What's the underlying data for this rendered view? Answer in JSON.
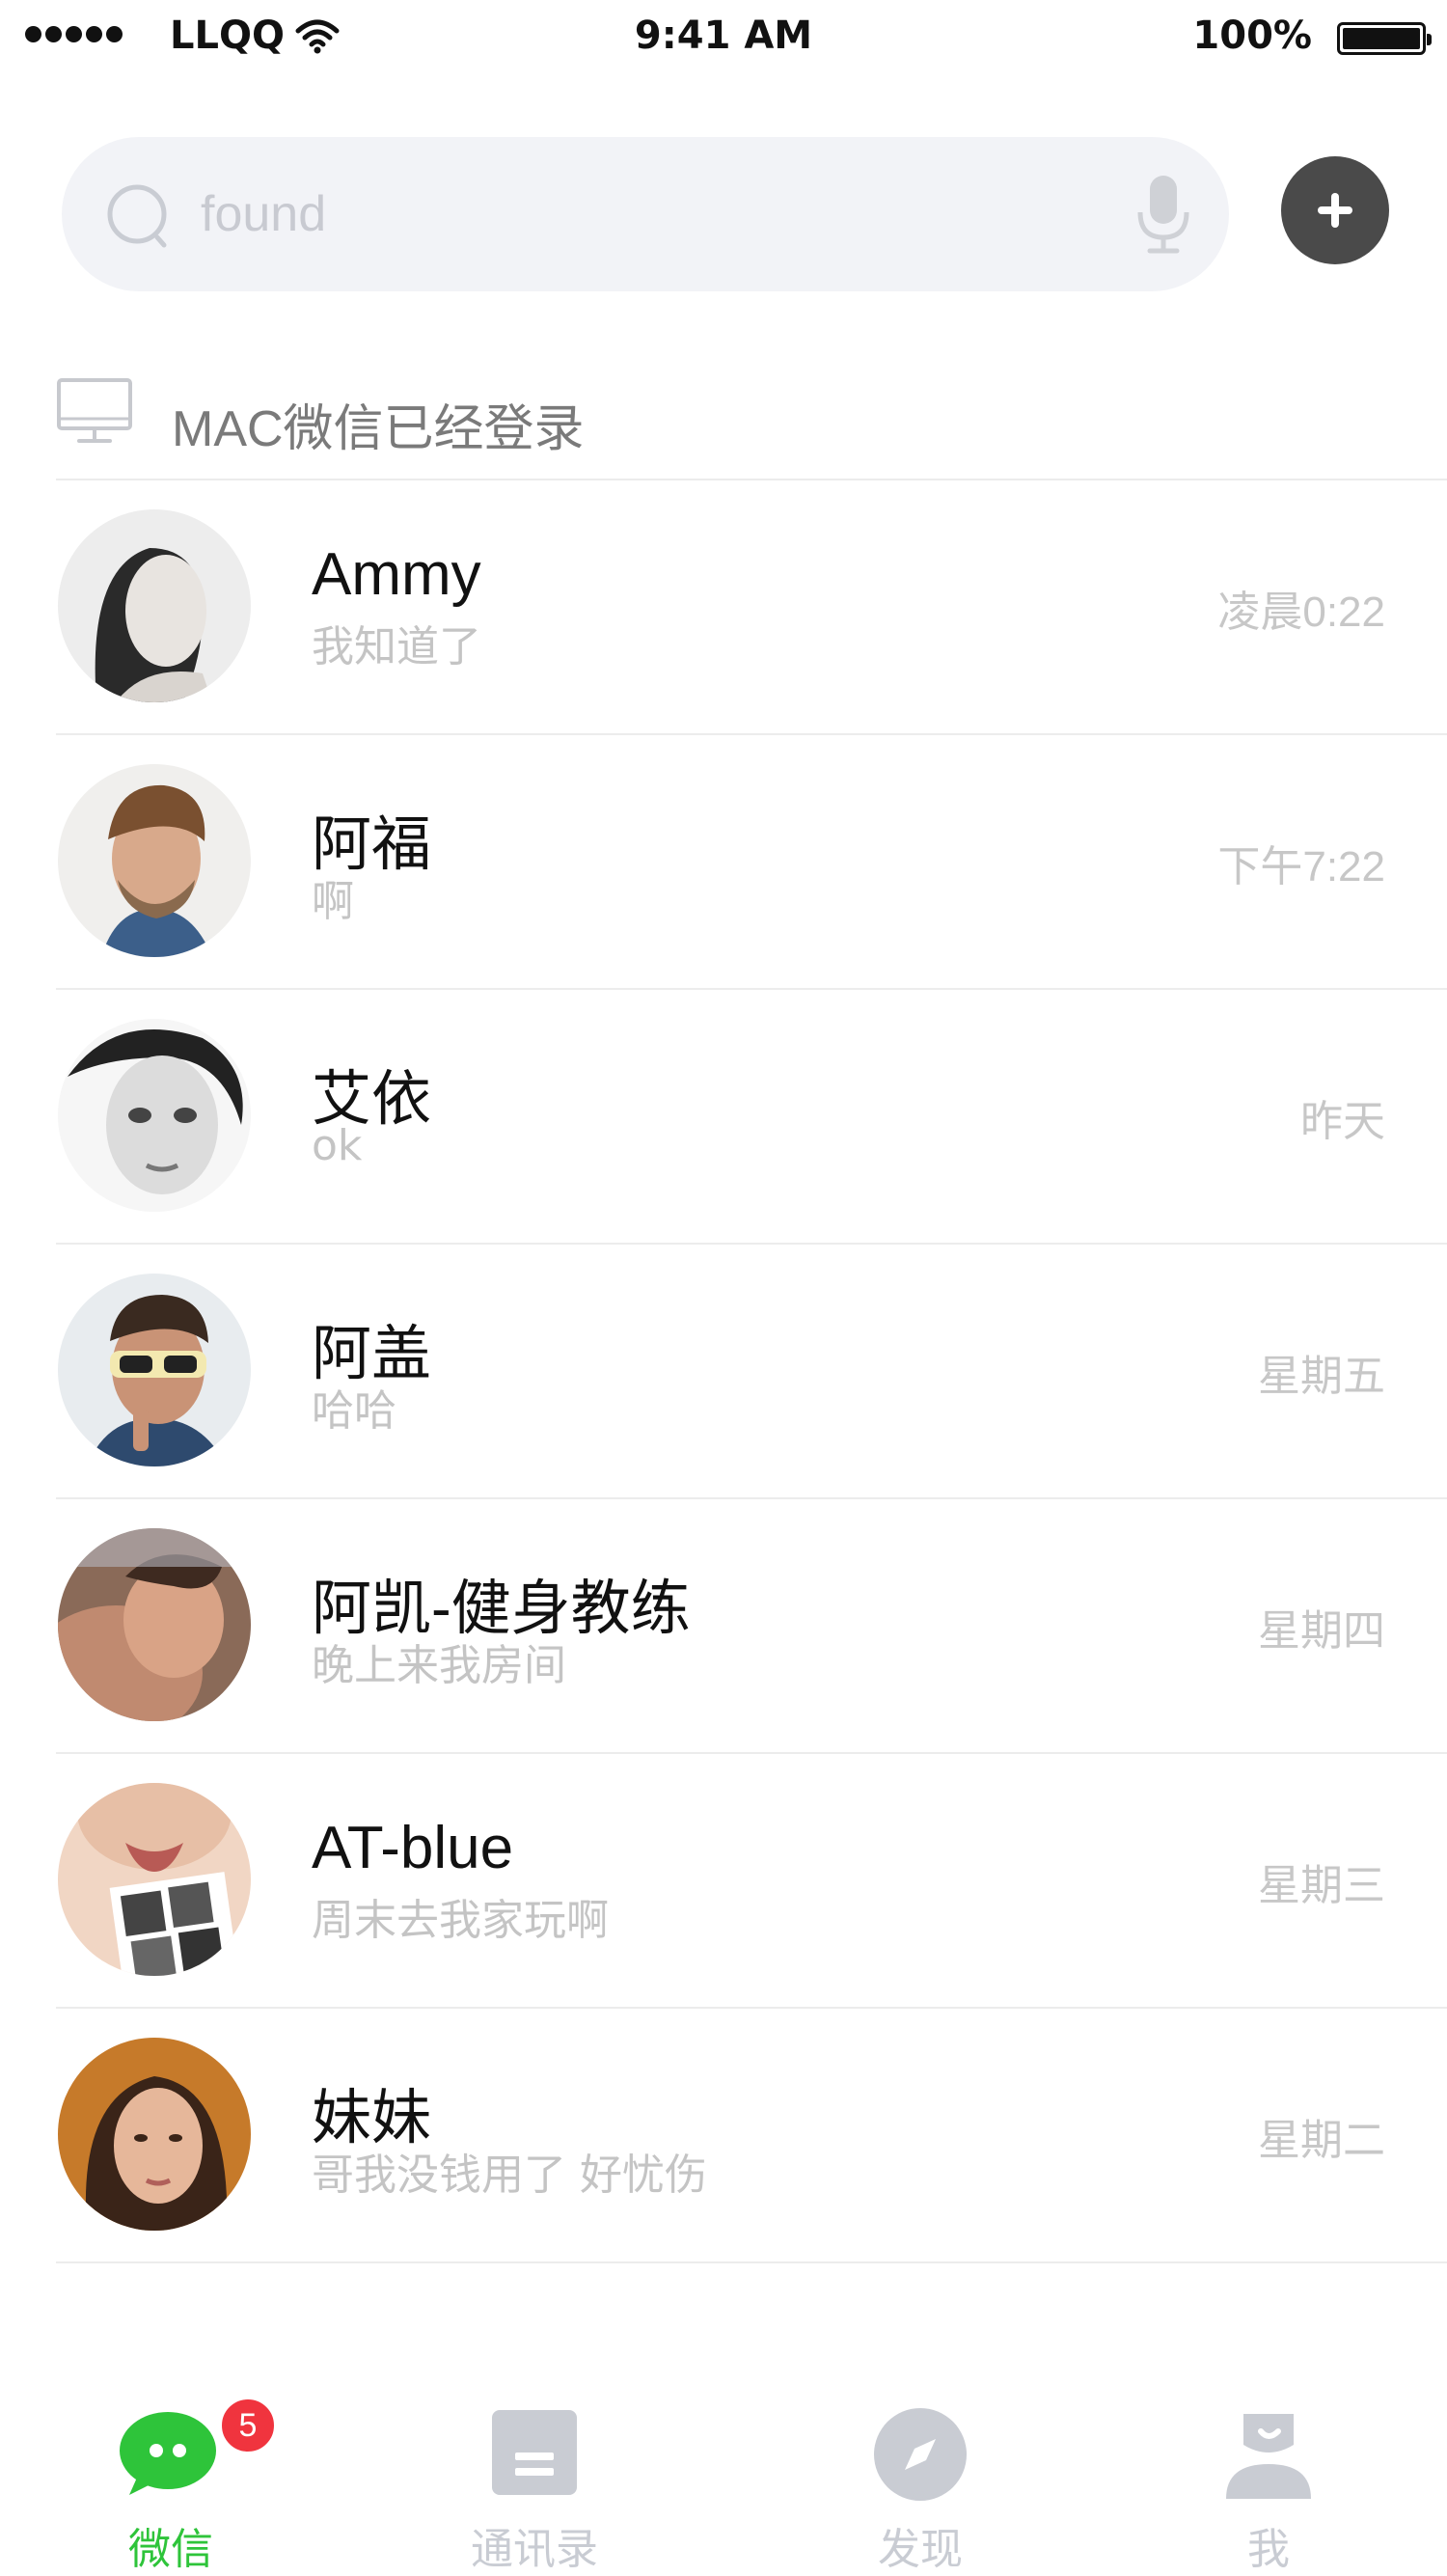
{
  "status_bar": {
    "carrier": "LLQQ",
    "time": "9:41 AM",
    "battery": "100%",
    "battery_level": 1.0
  },
  "search": {
    "placeholder": "found",
    "search_icon": "search-icon",
    "voice_icon": "microphone-icon",
    "add_icon": "plus-icon"
  },
  "banner": {
    "icon": "monitor-icon",
    "text": "MAC微信已经登录"
  },
  "chats": [
    {
      "name": "Ammy",
      "preview": "我知道了",
      "time": "凌晨0:22"
    },
    {
      "name": "阿福",
      "preview": "啊",
      "time": "下午7:22"
    },
    {
      "name": "艾依",
      "preview": "ok",
      "time": "昨天"
    },
    {
      "name": "阿盖",
      "preview": "哈哈",
      "time": "星期五"
    },
    {
      "name": "阿凯-健身教练",
      "preview": "晚上来我房间",
      "time": "星期四"
    },
    {
      "name": "AT-blue",
      "preview": "周末去我家玩啊",
      "time": "星期三"
    },
    {
      "name": "妹妹",
      "preview": "哥我没钱用了 好忧伤",
      "time": "星期二"
    }
  ],
  "tabs": [
    {
      "label": "微信",
      "icon": "chat-bubble-icon",
      "badge": "5",
      "active": true
    },
    {
      "label": "通讯录",
      "icon": "contacts-icon"
    },
    {
      "label": "发现",
      "icon": "compass-icon"
    },
    {
      "label": "我",
      "icon": "person-icon"
    }
  ],
  "colors": {
    "accent": "#2ec43a",
    "badge": "#f0343e",
    "add_button": "#4a4a4a"
  }
}
